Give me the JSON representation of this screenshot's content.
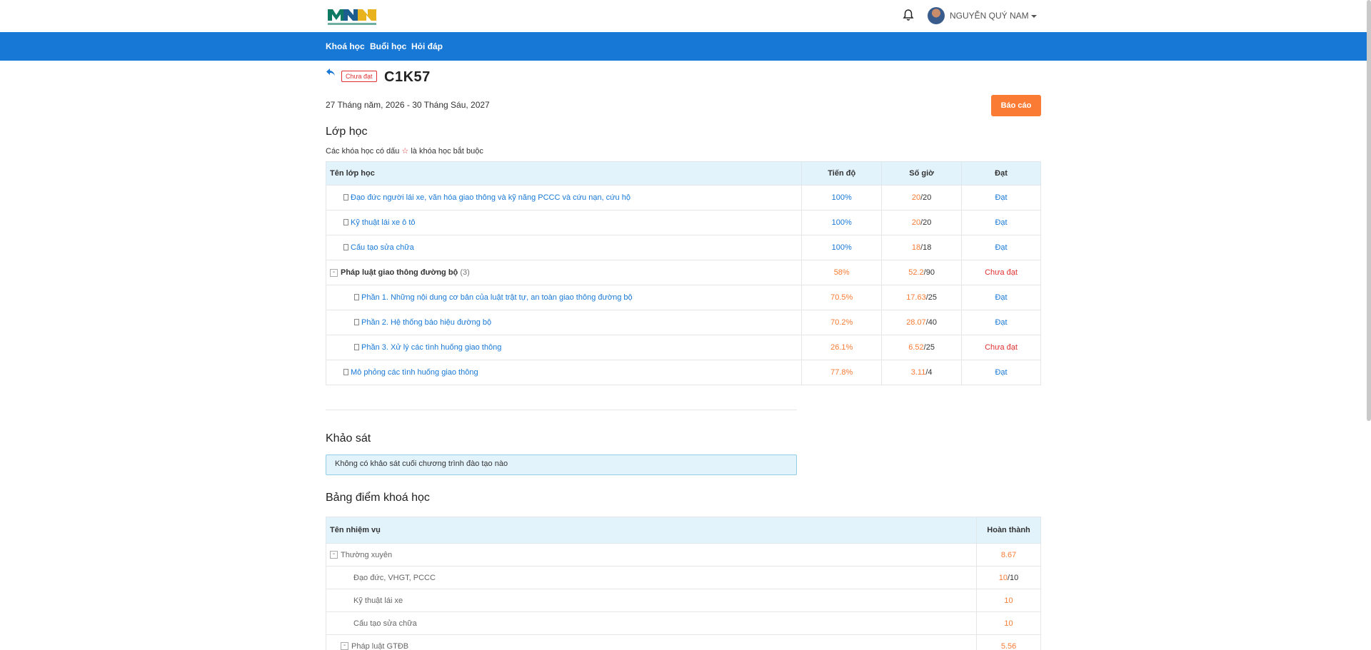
{
  "header": {
    "logo_text": "MINH KHANG NGUYEN",
    "user_name": "NGUYỄN QUÝ NAM"
  },
  "nav": {
    "items": [
      "Khoá học",
      "Buổi học",
      "Hỏi đáp"
    ]
  },
  "course": {
    "status_badge": "Chưa đạt",
    "title": "C1K57",
    "date_range": "27 Tháng năm, 2026 - 30 Tháng Sáu, 2027",
    "report_button": "Báo cáo"
  },
  "classes": {
    "heading": "Lớp học",
    "note_before": "Các khóa học có dấu ",
    "note_star": "☆",
    "note_after": " là khóa học bắt buộc",
    "columns": [
      "Tên lớp học",
      "Tiến độ",
      "Số giờ",
      "Đạt"
    ],
    "rows": [
      {
        "name": "Đạo đức người lái xe, văn hóa giao thông và kỹ năng PCCC và cứu nạn, cứu hộ",
        "progress": "100%",
        "hours_done": "20",
        "hours_total": "/20",
        "result": "Đạt"
      },
      {
        "name": "Kỹ thuật lái xe ô tô",
        "progress": "100%",
        "hours_done": "20",
        "hours_total": "/20",
        "result": "Đạt"
      },
      {
        "name": "Cấu tạo sửa chữa",
        "progress": "100%",
        "hours_done": "18",
        "hours_total": "/18",
        "result": "Đạt"
      },
      {
        "name": "Pháp luật giao thông đường bộ",
        "count": "(3)",
        "progress": "58%",
        "hours_done": "52.2",
        "hours_total": "/90",
        "result": "Chưa đạt"
      },
      {
        "name": "Phần 1. Những nội dung cơ bản của luật trật tự, an toàn giao thông đường bộ",
        "progress": "70.5%",
        "hours_done": "17.63",
        "hours_total": "/25",
        "result": "Đạt"
      },
      {
        "name": "Phần 2. Hệ thống báo hiệu đường bộ",
        "progress": "70.2%",
        "hours_done": "28.07",
        "hours_total": "/40",
        "result": "Đạt"
      },
      {
        "name": "Phần 3. Xử lý các tình huống giao thông",
        "progress": "26.1%",
        "hours_done": "6.52",
        "hours_total": "/25",
        "result": "Chưa đạt"
      },
      {
        "name": "Mô phỏng các tình huống giao thông",
        "progress": "77.8%",
        "hours_done": "3.11",
        "hours_total": "/4",
        "result": "Đạt"
      }
    ]
  },
  "survey": {
    "heading": "Khảo sát",
    "message": "Không có khảo sát cuối chương trình đào tạo nào"
  },
  "grades": {
    "heading": "Bảng điểm khoá học",
    "columns": [
      "Tên nhiệm vụ",
      "Hoàn thành"
    ],
    "rows": [
      {
        "name": "Thường xuyên",
        "value": "8.67",
        "total": ""
      },
      {
        "name": "Đạo đức, VHGT, PCCC",
        "value": "10",
        "total": "/10"
      },
      {
        "name": "Kỹ thuật lái xe",
        "value": "10",
        "total": ""
      },
      {
        "name": "Cấu tạo sửa chữa",
        "value": "10",
        "total": ""
      },
      {
        "name": "Pháp luật GTĐB",
        "value": "5.56",
        "total": ""
      }
    ]
  },
  "colors": {
    "nav_blue": "#1878d6",
    "accent_orange": "#f97b34",
    "fail_red": "#e03131",
    "table_header": "#e2f3fc"
  }
}
